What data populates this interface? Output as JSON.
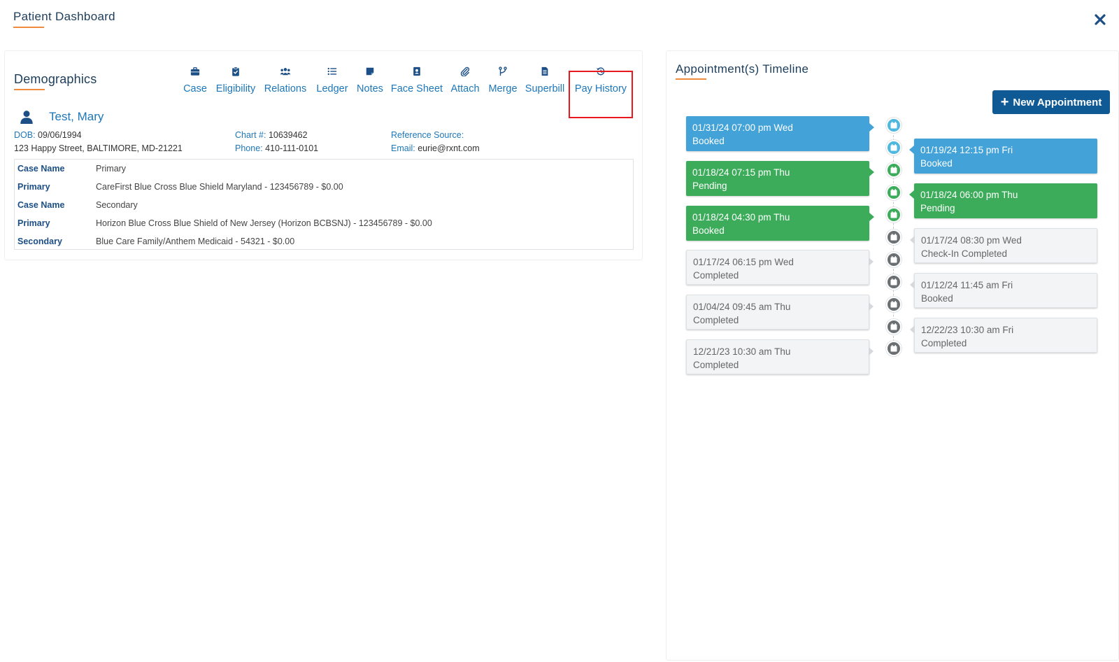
{
  "header": {
    "title": "Patient Dashboard"
  },
  "demographics": {
    "title": "Demographics",
    "actions": [
      {
        "label": "Case",
        "icon": "briefcase-icon"
      },
      {
        "label": "Eligibility",
        "icon": "clipboard-check-icon"
      },
      {
        "label": "Relations",
        "icon": "users-icon"
      },
      {
        "label": "Ledger",
        "icon": "list-icon"
      },
      {
        "label": "Notes",
        "icon": "sticky-note-icon"
      },
      {
        "label": "Face Sheet",
        "icon": "contact-card-icon"
      },
      {
        "label": "Attach",
        "icon": "paperclip-icon"
      },
      {
        "label": "Merge",
        "icon": "merge-icon"
      },
      {
        "label": "Superbill",
        "icon": "document-icon"
      },
      {
        "label": "Pay History",
        "icon": "history-icon"
      }
    ],
    "patient_name": "Test, Mary",
    "dob_label": "DOB:",
    "dob": "09/06/1994",
    "address": "123 Happy Street, BALTIMORE, MD-21221",
    "chart_label": "Chart #:",
    "chart": "10639462",
    "phone_label": "Phone:",
    "phone": "410-111-0101",
    "reference_label": "Reference Source:",
    "email_label": "Email:",
    "email": "eurie@rxnt.com",
    "cases": [
      {
        "key": "Case Name",
        "value": "Primary"
      },
      {
        "key": "Primary",
        "value": "CareFirst Blue Cross Blue Shield Maryland - 123456789 - $0.00"
      },
      {
        "key": "Case Name",
        "value": "Secondary"
      },
      {
        "key": "Primary",
        "value": "Horizon Blue Cross Blue Shield of New Jersey (Horizon BCBSNJ) - 123456789 - $0.00"
      },
      {
        "key": "Secondary",
        "value": "Blue Care Family/Anthem Medicaid - 54321 - $0.00"
      }
    ]
  },
  "timeline": {
    "title": "Appointment(s) Timeline",
    "new_button": "New Appointment",
    "left": [
      {
        "date": "01/31/24 07:00 pm Wed",
        "status": "Booked",
        "color": "#43a2d8"
      },
      {
        "date": "01/18/24 07:15 pm Thu",
        "status": "Pending",
        "color": "#3cac5a"
      },
      {
        "date": "01/18/24 04:30 pm Thu",
        "status": "Booked",
        "color": "#3cac5a"
      },
      {
        "date": "01/17/24 06:15 pm Wed",
        "status": "Completed",
        "color": "#f2f4f5"
      },
      {
        "date": "01/04/24 09:45 am Thu",
        "status": "Completed",
        "color": "#f2f4f5"
      },
      {
        "date": "12/21/23 10:30 am Thu",
        "status": "Completed",
        "color": "#f2f4f5"
      }
    ],
    "right": [
      {
        "date": "01/19/24 12:15 pm Fri",
        "status": "Booked",
        "color": "#43a2d8"
      },
      {
        "date": "01/18/24 06:00 pm Thu",
        "status": "Pending",
        "color": "#3cac5a"
      },
      {
        "date": "01/17/24 08:30 pm Wed",
        "status": "Check-In Completed",
        "color": "#f2f4f5"
      },
      {
        "date": "01/12/24 11:45 am Fri",
        "status": "Booked",
        "color": "#f2f4f5"
      },
      {
        "date": "12/22/23 10:30 am Fri",
        "status": "Completed",
        "color": "#f2f4f5"
      }
    ]
  },
  "colors": {
    "accent": "#f08a3c",
    "link": "#1d77b8",
    "primary_button": "#0f5a95",
    "highlight": "#e8191e"
  }
}
